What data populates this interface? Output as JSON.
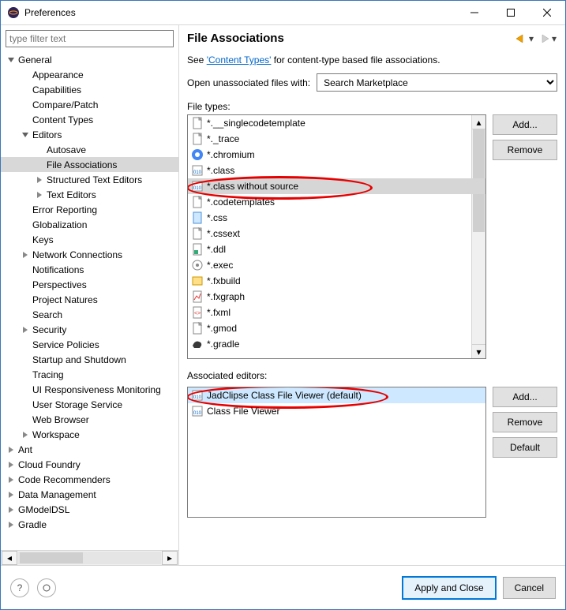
{
  "window": {
    "title": "Preferences"
  },
  "filter": {
    "placeholder": "type filter text"
  },
  "tree": [
    {
      "d": 0,
      "exp": "open",
      "label": "General"
    },
    {
      "d": 1,
      "exp": "none",
      "label": "Appearance"
    },
    {
      "d": 1,
      "exp": "none",
      "label": "Capabilities"
    },
    {
      "d": 1,
      "exp": "none",
      "label": "Compare/Patch"
    },
    {
      "d": 1,
      "exp": "none",
      "label": "Content Types"
    },
    {
      "d": 1,
      "exp": "open",
      "label": "Editors"
    },
    {
      "d": 2,
      "exp": "none",
      "label": "Autosave"
    },
    {
      "d": 2,
      "exp": "none",
      "label": "File Associations",
      "selected": true
    },
    {
      "d": 2,
      "exp": "closed",
      "label": "Structured Text Editors"
    },
    {
      "d": 2,
      "exp": "closed",
      "label": "Text Editors"
    },
    {
      "d": 1,
      "exp": "none",
      "label": "Error Reporting"
    },
    {
      "d": 1,
      "exp": "none",
      "label": "Globalization"
    },
    {
      "d": 1,
      "exp": "none",
      "label": "Keys"
    },
    {
      "d": 1,
      "exp": "closed",
      "label": "Network Connections"
    },
    {
      "d": 1,
      "exp": "none",
      "label": "Notifications"
    },
    {
      "d": 1,
      "exp": "none",
      "label": "Perspectives"
    },
    {
      "d": 1,
      "exp": "none",
      "label": "Project Natures"
    },
    {
      "d": 1,
      "exp": "none",
      "label": "Search"
    },
    {
      "d": 1,
      "exp": "closed",
      "label": "Security"
    },
    {
      "d": 1,
      "exp": "none",
      "label": "Service Policies"
    },
    {
      "d": 1,
      "exp": "none",
      "label": "Startup and Shutdown"
    },
    {
      "d": 1,
      "exp": "none",
      "label": "Tracing"
    },
    {
      "d": 1,
      "exp": "none",
      "label": "UI Responsiveness Monitoring"
    },
    {
      "d": 1,
      "exp": "none",
      "label": "User Storage Service"
    },
    {
      "d": 1,
      "exp": "none",
      "label": "Web Browser"
    },
    {
      "d": 1,
      "exp": "closed",
      "label": "Workspace"
    },
    {
      "d": 0,
      "exp": "closed",
      "label": "Ant"
    },
    {
      "d": 0,
      "exp": "closed",
      "label": "Cloud Foundry"
    },
    {
      "d": 0,
      "exp": "closed",
      "label": "Code Recommenders"
    },
    {
      "d": 0,
      "exp": "closed",
      "label": "Data Management"
    },
    {
      "d": 0,
      "exp": "closed",
      "label": "GModelDSL"
    },
    {
      "d": 0,
      "exp": "closed",
      "label": "Gradle"
    }
  ],
  "page": {
    "heading": "File Associations",
    "intro_prefix": "See ",
    "intro_link": "'Content Types'",
    "intro_suffix": " for content-type based file associations.",
    "open_with_label": "Open unassociated files with:",
    "open_with_value": "Search Marketplace",
    "filetypes_label": "File types:",
    "assoc_label": "Associated editors:"
  },
  "filetypes": [
    {
      "icon": "file",
      "label": "*.__singlecodetemplate"
    },
    {
      "icon": "file",
      "label": "*._trace"
    },
    {
      "icon": "chromium",
      "label": "*.chromium"
    },
    {
      "icon": "class",
      "label": "*.class"
    },
    {
      "icon": "class",
      "label": "*.class without source",
      "selected": true,
      "circle": true
    },
    {
      "icon": "file",
      "label": "*.codetemplates"
    },
    {
      "icon": "css",
      "label": "*.css"
    },
    {
      "icon": "file",
      "label": "*.cssext"
    },
    {
      "icon": "ddl",
      "label": "*.ddl"
    },
    {
      "icon": "exec",
      "label": "*.exec"
    },
    {
      "icon": "fxbuild",
      "label": "*.fxbuild"
    },
    {
      "icon": "fxgraph",
      "label": "*.fxgraph"
    },
    {
      "icon": "fxml",
      "label": "*.fxml"
    },
    {
      "icon": "file",
      "label": "*.gmod"
    },
    {
      "icon": "gradle",
      "label": "*.gradle"
    }
  ],
  "editors": [
    {
      "icon": "class",
      "label": "JadClipse Class File Viewer (default)",
      "selected": true,
      "circle": true
    },
    {
      "icon": "class",
      "label": "Class File Viewer"
    }
  ],
  "buttons": {
    "add": "Add...",
    "remove": "Remove",
    "default": "Default",
    "apply_close": "Apply and Close",
    "cancel": "Cancel"
  }
}
